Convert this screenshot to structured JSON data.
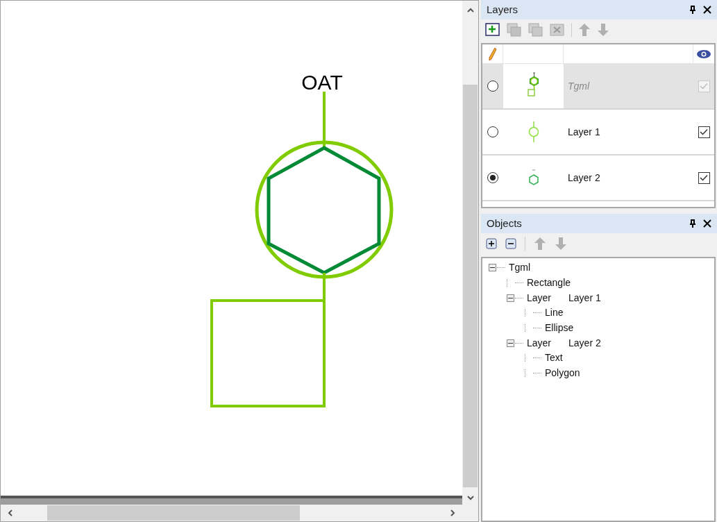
{
  "canvas": {
    "label": "OAT"
  },
  "layers_panel": {
    "title": "Layers",
    "rows": [
      {
        "kind": "document",
        "name": "Tgml",
        "selected": false,
        "visible": true,
        "disabled": true
      },
      {
        "kind": "line-ellipse",
        "name": "Layer 1",
        "selected": false,
        "visible": true,
        "disabled": false
      },
      {
        "kind": "polygon",
        "name": "Layer 2",
        "selected": true,
        "visible": true,
        "disabled": false
      }
    ]
  },
  "objects_panel": {
    "title": "Objects",
    "tree": [
      {
        "label": "Tgml",
        "expanded": true,
        "children": [
          {
            "label": "Rectangle"
          },
          {
            "label": "Layer",
            "detail": "Layer 1",
            "expanded": true,
            "children": [
              {
                "label": "Line"
              },
              {
                "label": "Ellipse"
              }
            ]
          },
          {
            "label": "Layer",
            "detail": "Layer 2",
            "expanded": true,
            "children": [
              {
                "label": "Text"
              },
              {
                "label": "Polygon"
              }
            ]
          }
        ]
      }
    ]
  }
}
